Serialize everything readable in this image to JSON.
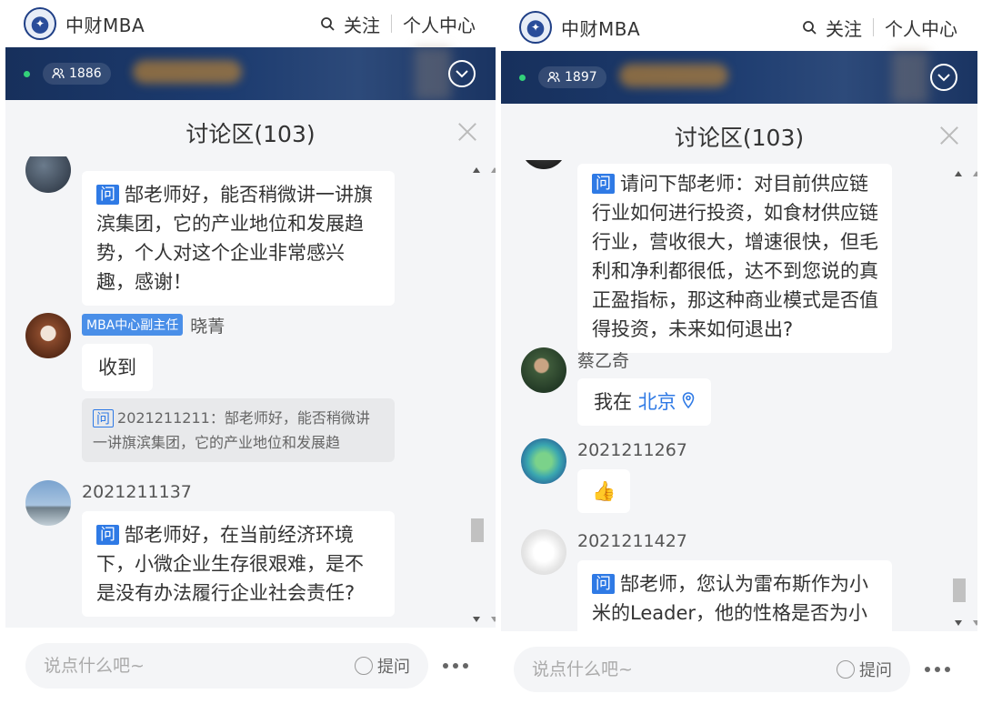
{
  "left": {
    "brand": "中财MBA",
    "follow": "关注",
    "profile": "个人中心",
    "viewers": "1886",
    "disc_title": "讨论区(103)",
    "partial_name": "2021211211",
    "msg1_text": "郜老师好，能否稍微讲一讲旗滨集团，它的产业地位和发展趋势，个人对这个企业非常感兴趣，感谢！",
    "msg2_role": "MBA中心副主任",
    "msg2_name": "晓菁",
    "msg2_text": "收到",
    "msg2_quote": "2021211211：郜老师好，能否稍微讲一讲旗滨集团，它的产业地位和发展趋",
    "msg3_name": "2021211137",
    "msg3_text": "郜老师好，在当前经济环境下，小微企业生存很艰难，是不是没有办法履行企业社会责任?",
    "input_placeholder": "说点什么吧~",
    "ask_label": "提问",
    "q_label": "问"
  },
  "right": {
    "brand": "中财MBA",
    "follow": "关注",
    "profile": "个人中心",
    "viewers": "1897",
    "disc_title": "讨论区(103)",
    "msg1_text": "请问下郜老师：对目前供应链行业如何进行投资，如食材供应链行业，营收很大，增速很快，但毛利和净利都很低，达不到您说的真正盈指标，那这种商业模式是否值得投资，未来如何退出?",
    "msg2_name": "蔡乙奇",
    "msg2_text": "我在",
    "msg2_loc": "北京",
    "msg3_name": "2021211267",
    "msg3_emoji": "👍",
    "msg4_name": "2021211427",
    "msg4_text": "郜老师，您认为雷布斯作为小米的Leader，他的性格是否为小米",
    "input_placeholder": "说点什么吧~",
    "ask_label": "提问",
    "q_label": "问"
  },
  "colors": {
    "accent": "#2f7ae5",
    "banner": "#1c3b6f",
    "role_tag": "#4a8fe8"
  }
}
